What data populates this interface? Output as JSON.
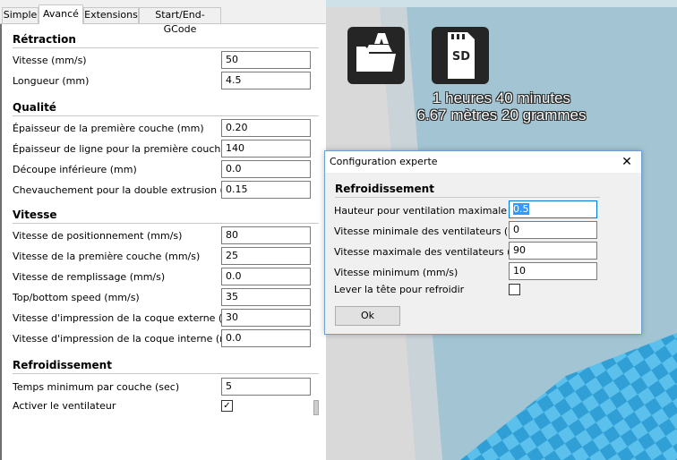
{
  "tabs": [
    {
      "label": "Simple",
      "active": false
    },
    {
      "label": "Avancé",
      "active": true
    },
    {
      "label": "Extensions",
      "active": false
    },
    {
      "label": "Start/End-GCode",
      "active": false
    }
  ],
  "settings": {
    "retraction": {
      "title": "Rétraction",
      "fields": [
        {
          "label": "Vitesse (mm/s)",
          "value": "50"
        },
        {
          "label": "Longueur (mm)",
          "value": "4.5"
        }
      ]
    },
    "quality": {
      "title": "Qualité",
      "fields": [
        {
          "label": "Épaisseur de la première couche (mm)",
          "value": "0.20"
        },
        {
          "label": "Épaisseur de ligne pour la première couche (%)",
          "value": "140"
        },
        {
          "label": "Découpe inférieure (mm)",
          "value": "0.0"
        },
        {
          "label": "Chevauchement pour la double extrusion (mm)",
          "value": "0.15"
        }
      ]
    },
    "speed": {
      "title": "Vitesse",
      "fields": [
        {
          "label": "Vitesse de positionnement (mm/s)",
          "value": "80"
        },
        {
          "label": "Vitesse de la première couche (mm/s)",
          "value": "25"
        },
        {
          "label": "Vitesse de remplissage (mm/s)",
          "value": "0.0"
        },
        {
          "label": "Top/bottom speed (mm/s)",
          "value": "35"
        },
        {
          "label": "Vitesse d'impression de la coque externe (mm/s)",
          "value": "30"
        },
        {
          "label": "Vitesse d'impression de la coque interne (mm/s)",
          "value": "0.0"
        }
      ]
    },
    "cooling": {
      "title": "Refroidissement",
      "min_layer_time": {
        "label": "Temps minimum par couche (sec)",
        "value": "5"
      },
      "fan_enable": {
        "label": "Activer le ventilateur",
        "checked": true,
        "mark": "✓"
      }
    }
  },
  "toolbar": {
    "load_icon": "load-model-icon",
    "sd_icon": "sd-card-icon",
    "sd_label": "SD"
  },
  "print_info": {
    "time": "1 heures 40 minutes",
    "material": "6.67 mètres 20 grammes"
  },
  "dialog": {
    "title": "Configuration experte",
    "close_glyph": "✕",
    "section_title": "Refroidissement",
    "fan_full_height": {
      "label": "Hauteur pour ventilation maximale (mm)",
      "value": "0.5"
    },
    "fan_min": {
      "label": "Vitesse minimale des ventilateurs (%)",
      "value": "0"
    },
    "fan_max": {
      "label": "Vitesse maximale des ventilateurs (%)",
      "value": "90"
    },
    "min_speed": {
      "label": "Vitesse minimum (mm/s)",
      "value": "10"
    },
    "cool_head_lift": {
      "label": "Lever la tête pour refroidir",
      "checked": false
    },
    "ok_label": "Ok"
  },
  "colors": {
    "viewport_bg": "#a3c5d3",
    "platform_light": "#5bc0eb",
    "platform_dark": "#2f9fd6",
    "gray_wall": "#d9d9d9",
    "toolbar_btn": "#252525"
  }
}
